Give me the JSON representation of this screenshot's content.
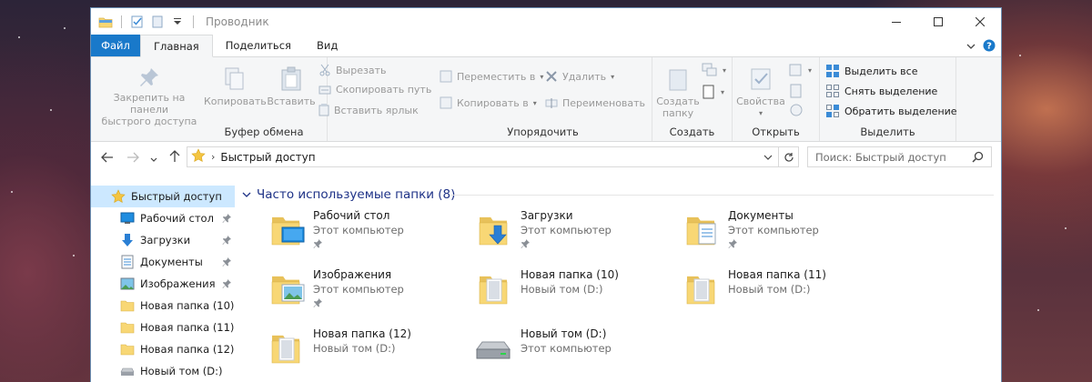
{
  "window": {
    "title": "Проводник"
  },
  "window_controls": [
    "minimize",
    "maximize",
    "close"
  ],
  "ribbon_tabs": [
    {
      "label": "Файл",
      "kind": "file"
    },
    {
      "label": "Главная",
      "kind": "active"
    },
    {
      "label": "Поделиться",
      "kind": "normal"
    },
    {
      "label": "Вид",
      "kind": "normal"
    }
  ],
  "clipboard": {
    "label": "Буфер обмена",
    "pin_label": "Закрепить на панели быстрого доступа",
    "pin_line1": "Закрепить на панели",
    "pin_line2": "быстрого доступа",
    "copy": "Копировать",
    "paste": "Вставить",
    "cut": "Вырезать",
    "copy_path": "Скопировать путь",
    "paste_shortcut": "Вставить ярлык"
  },
  "organize": {
    "label": "Упорядочить",
    "move_to": "Переместить в",
    "copy_to": "Копировать в",
    "delete": "Удалить",
    "rename": "Переименовать"
  },
  "create": {
    "label": "Создать",
    "new_folder_line1": "Создать",
    "new_folder_line2": "папку"
  },
  "open": {
    "label": "Открыть",
    "properties": "Свойства"
  },
  "select": {
    "label": "Выделить",
    "select_all": "Выделить все",
    "select_none": "Снять выделение",
    "invert": "Обратить выделение"
  },
  "address": {
    "path": "Быстрый доступ",
    "search_placeholder": "Поиск: Быстрый доступ"
  },
  "nav_pane": {
    "items": [
      {
        "label": "Быстрый доступ",
        "icon": "star-icon",
        "pinned": false,
        "selected": true
      },
      {
        "label": "Рабочий стол",
        "icon": "desktop-icon",
        "pinned": true,
        "selected": false
      },
      {
        "label": "Загрузки",
        "icon": "download-icon",
        "pinned": true,
        "selected": false
      },
      {
        "label": "Документы",
        "icon": "document-icon",
        "pinned": true,
        "selected": false
      },
      {
        "label": "Изображения",
        "icon": "image-icon",
        "pinned": true,
        "selected": false
      },
      {
        "label": "Новая папка (10)",
        "icon": "folder-icon",
        "pinned": false,
        "selected": false
      },
      {
        "label": "Новая папка (11)",
        "icon": "folder-icon",
        "pinned": false,
        "selected": false
      },
      {
        "label": "Новая папка (12)",
        "icon": "folder-icon",
        "pinned": false,
        "selected": false
      },
      {
        "label": "Новый том (D:)",
        "icon": "drive-icon",
        "pinned": false,
        "selected": false
      }
    ]
  },
  "frequent": {
    "header": "Часто используемые папки (8)",
    "items": [
      {
        "name": "Рабочий стол",
        "location": "Этот компьютер",
        "pinned": true,
        "icon": "desktop-folder-icon"
      },
      {
        "name": "Загрузки",
        "location": "Этот компьютер",
        "pinned": true,
        "icon": "downloads-folder-icon"
      },
      {
        "name": "Документы",
        "location": "Этот компьютер",
        "pinned": true,
        "icon": "documents-folder-icon"
      },
      {
        "name": "Изображения",
        "location": "Этот компьютер",
        "pinned": true,
        "icon": "pictures-folder-icon"
      },
      {
        "name": "Новая папка (10)",
        "location": "Новый том (D:)",
        "pinned": false,
        "icon": "folder-icon"
      },
      {
        "name": "Новая папка (11)",
        "location": "Новый том (D:)",
        "pinned": false,
        "icon": "folder-icon"
      },
      {
        "name": "Новая папка (12)",
        "location": "Новый том (D:)",
        "pinned": false,
        "icon": "folder-icon"
      },
      {
        "name": "Новый том (D:)",
        "location": "Этот компьютер",
        "pinned": false,
        "icon": "drive-icon"
      }
    ]
  },
  "colors": {
    "file_tab": "#1979ca",
    "selection": "#cce8ff",
    "section_header": "#1e3287",
    "folder": "#f8d775"
  }
}
